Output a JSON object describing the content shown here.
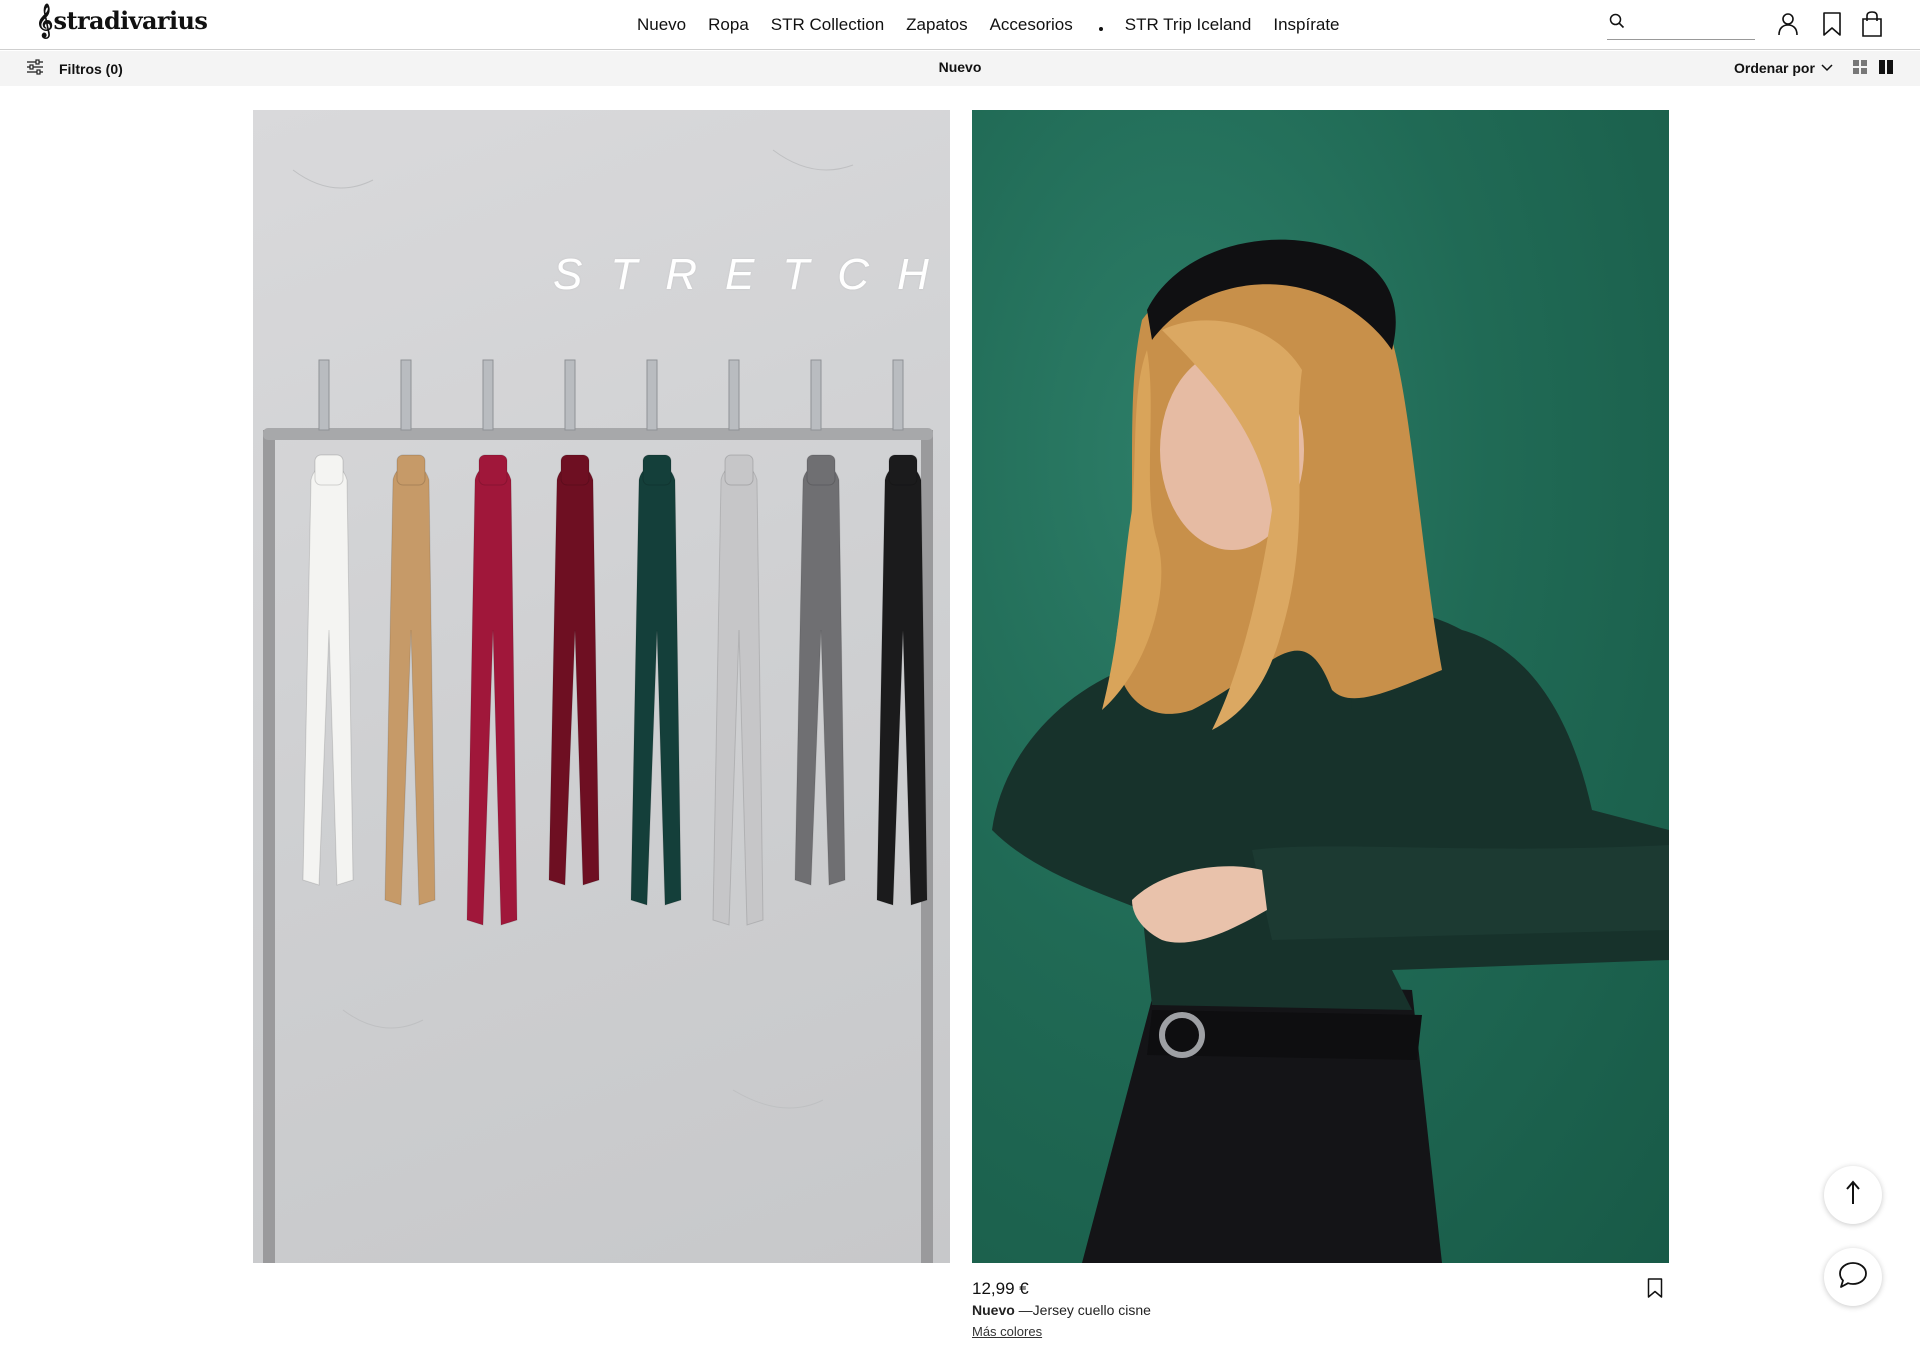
{
  "header": {
    "logo_text": "stradivarius",
    "logo_mark": "𝄞",
    "nav": [
      {
        "label": "Nuevo"
      },
      {
        "label": "Ropa"
      },
      {
        "label": "STR Collection"
      },
      {
        "label": "Zapatos"
      },
      {
        "label": "Accesorios"
      },
      {
        "label": "STR Trip Iceland"
      },
      {
        "label": "Inspírate"
      }
    ],
    "search": {
      "value": "",
      "placeholder": ""
    },
    "icons": [
      "search-icon",
      "user-icon",
      "bookmark-icon",
      "shopping-bag-icon"
    ]
  },
  "subbar": {
    "filters_label": "Filtros (0)",
    "title": "Nuevo",
    "sort_label": "Ordenar por",
    "icons": [
      "sliders-icon",
      "chevron-down-icon",
      "grid-small-icon",
      "grid-large-icon"
    ]
  },
  "products": [
    {
      "image_text": "STRETCH",
      "swatch_colors": [
        "#f4f4f2",
        "#c69a68",
        "#a0173a",
        "#6e0f22",
        "#143f3a",
        "#c6c6c8",
        "#6f6f72",
        "#1b1b1c"
      ]
    },
    {
      "price": "12,99 €",
      "tag": "Nuevo",
      "name": " —Jersey cuello cisne",
      "more_colors": "Más colores",
      "colors": {
        "background": "#206a55",
        "sweater": "#17322b",
        "hair": "#d7a45c",
        "pants": "#16161a"
      }
    }
  ],
  "floating": {
    "icons": [
      "arrow-up-icon",
      "chat-icon"
    ]
  },
  "colors": {
    "text": "#111111",
    "subbar_bg": "#f4f4f4",
    "border": "#cfcfcf"
  }
}
